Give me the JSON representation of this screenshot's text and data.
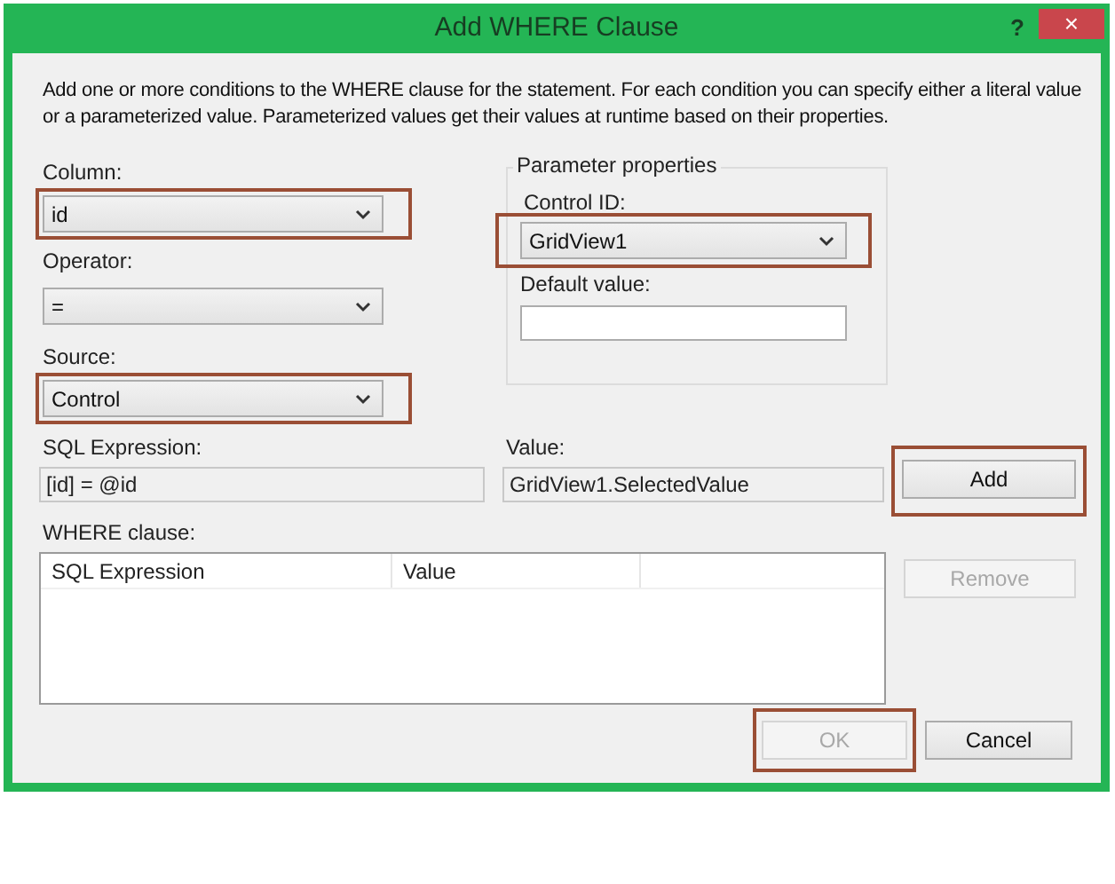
{
  "window": {
    "title": "Add WHERE Clause",
    "help": "?",
    "close": "×"
  },
  "description": "Add one or more conditions to the WHERE clause for the statement. For each condition you can specify either a literal value or a parameterized value. Parameterized values get their values at runtime based on their properties.",
  "column": {
    "label": "Column:",
    "value": "id",
    "highlighted": true
  },
  "operator": {
    "label": "Operator:",
    "value": "=",
    "highlighted": false
  },
  "source": {
    "label": "Source:",
    "value": "Control",
    "highlighted": true
  },
  "parameter_properties": {
    "title": "Parameter properties",
    "control_id": {
      "label": "Control ID:",
      "value": "GridView1",
      "highlighted": true
    },
    "default_value": {
      "label": "Default value:"
    }
  },
  "sql_expression": {
    "label": "SQL Expression:",
    "value": "[id] = @id"
  },
  "value": {
    "label": "Value:",
    "value": "GridView1.SelectedValue"
  },
  "add_button": {
    "label": "Add",
    "highlighted": true,
    "disabled": false
  },
  "where_clause": {
    "label": "WHERE clause:",
    "columns": [
      "SQL Expression",
      "Value"
    ]
  },
  "remove_button": {
    "label": "Remove",
    "highlighted": false,
    "disabled": true
  },
  "ok_button": {
    "label": "OK",
    "highlighted": true,
    "disabled": true
  },
  "cancel_button": {
    "label": "Cancel",
    "highlighted": false,
    "disabled": false
  }
}
